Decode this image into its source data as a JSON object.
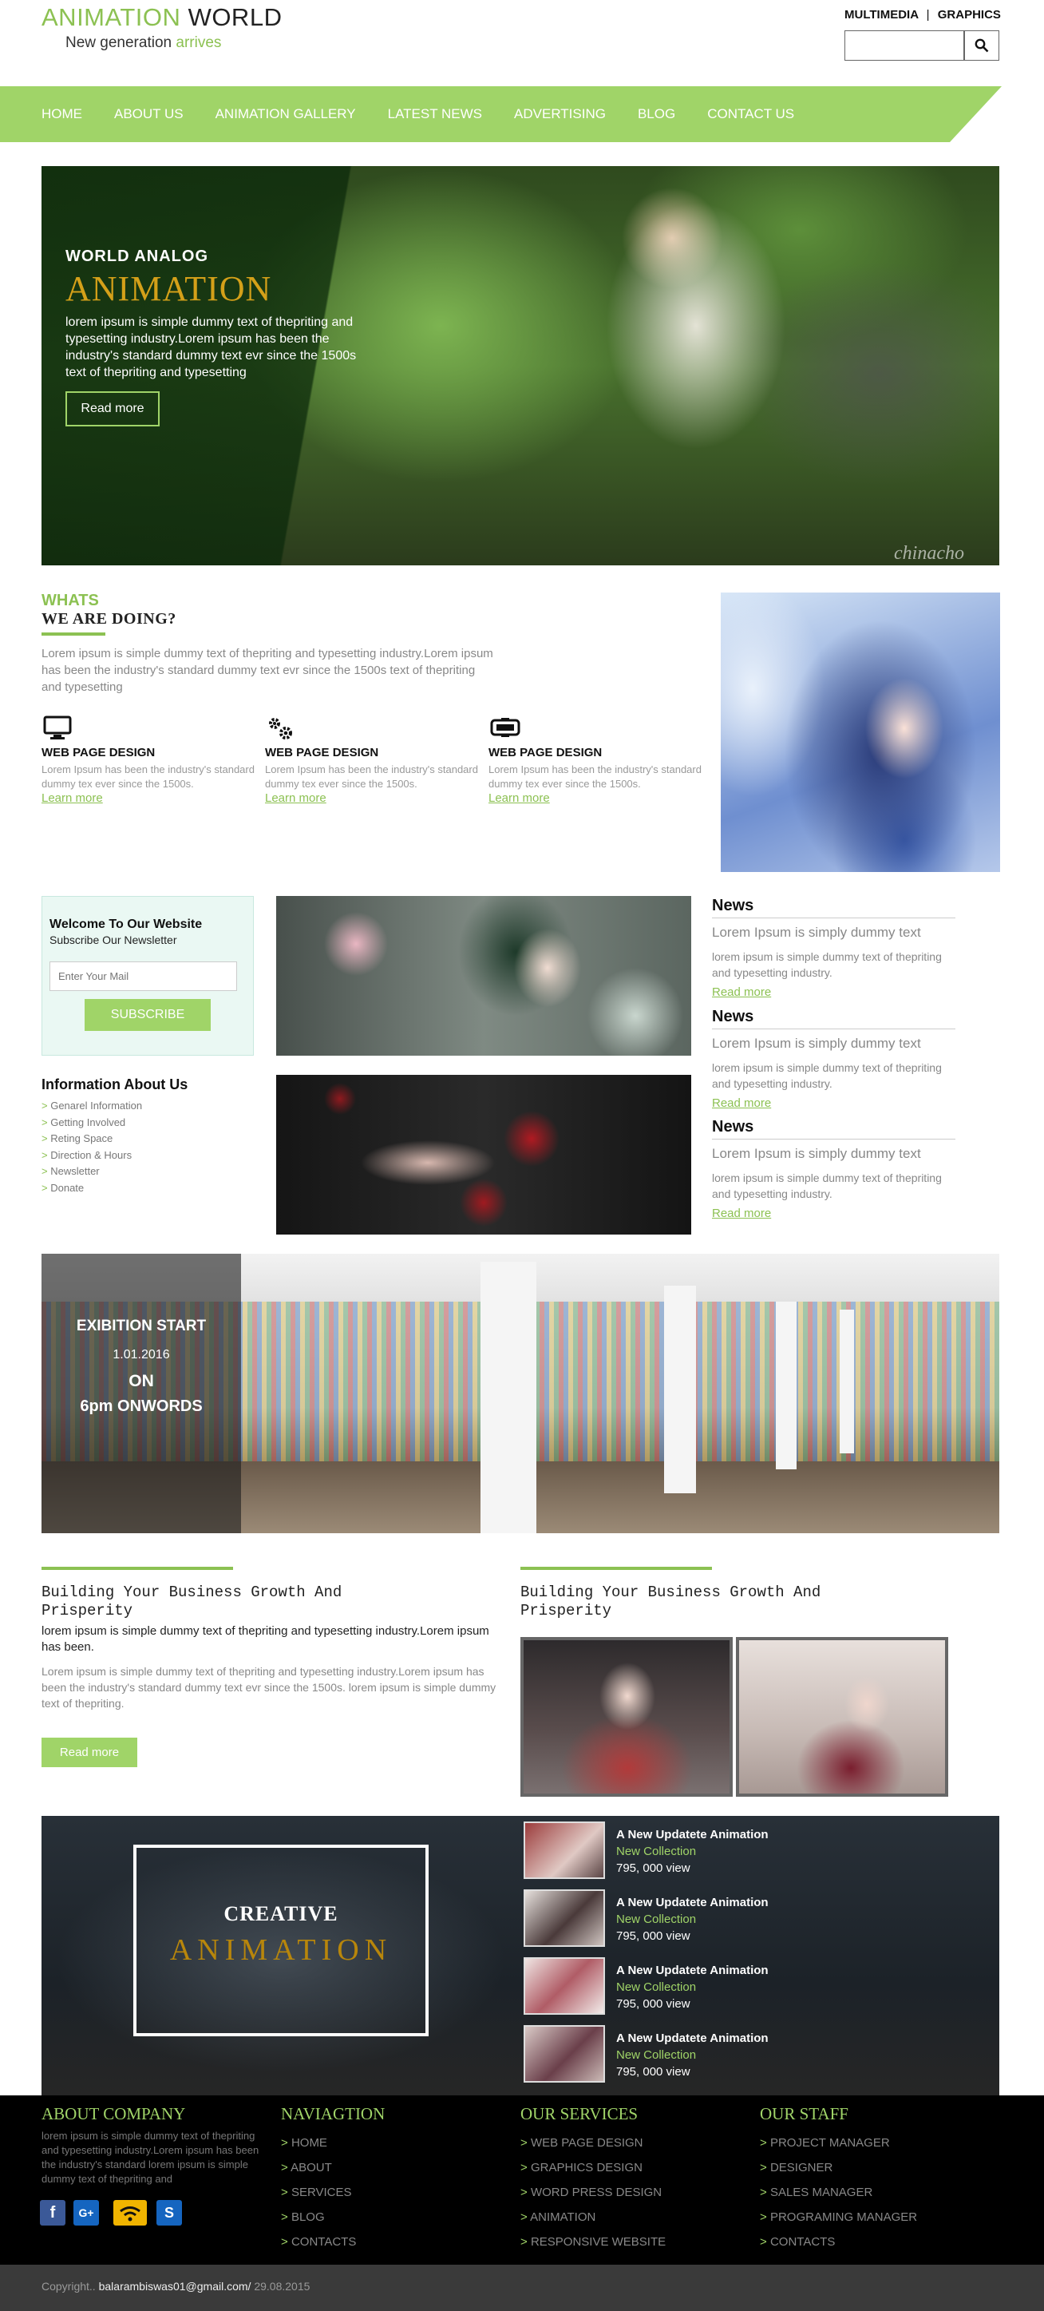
{
  "header": {
    "logo_main": "ANIMATION",
    "logo_accent": "WORLD",
    "tagline_main": "New generation",
    "tagline_accent": "arrives",
    "top_link_1": "MULTIMEDIA",
    "top_sep": "|",
    "top_link_2": "GRAPHICS",
    "search_placeholder": "",
    "search_icon": "search-icon"
  },
  "nav": {
    "items": [
      "HOME",
      "ABOUT US",
      "ANIMATION GALLERY",
      "LATEST NEWS",
      "ADVERTISING",
      "BLOG",
      "CONTACT US"
    ]
  },
  "hero": {
    "small_title": "WORLD  ANALOG",
    "big_title": "ANIMATION",
    "text": "lorem ipsum is simple dummy text of thepriting and typesetting industry.Lorem ipsum has been the industry's standard dummy text evr since the 1500s text of thepriting and typesetting",
    "button": "Read more",
    "watermark": "chinacho"
  },
  "whats": {
    "title_1": "WHATS",
    "title_2": "WE ARE DOING?",
    "text": "Lorem ipsum is simple dummy text of thepriting and typesetting industry.Lorem ipsum has been the industry's standard dummy text evr since the 1500s text of thepriting and typesetting",
    "services": [
      {
        "icon": "monitor-icon",
        "title": "WEB PAGE DESIGN",
        "desc": "Lorem Ipsum has been the industry's standard dummy tex ever since the 1500s.",
        "link": "Learn more"
      },
      {
        "icon": "gears-icon",
        "title": "WEB PAGE DESIGN",
        "desc": "Lorem Ipsum has been the industry's standard dummy tex ever since the 1500s.",
        "link": "Learn more"
      },
      {
        "icon": "device-icon",
        "title": "WEB PAGE DESIGN",
        "desc": "Lorem Ipsum has been the industry's standard dummy tex ever since the 1500s.",
        "link": "Learn more"
      }
    ]
  },
  "newsletter": {
    "title": "Welcome To Our Website",
    "subtitle": "Subscribe Our Newsletter",
    "placeholder": "Enter Your Mail",
    "button": "SUBSCRIBE"
  },
  "info": {
    "title": "Information About Us",
    "items": [
      "Genarel Information",
      "Getting Involved",
      "Reting Space",
      "Direction & Hours",
      "Newsletter",
      "Donate"
    ]
  },
  "news": [
    {
      "heading": "News",
      "subtitle": "Lorem Ipsum is simply dummy text",
      "text": "lorem ipsum is simple dummy text of thepriting and typesetting industry.",
      "link": "Read more"
    },
    {
      "heading": "News",
      "subtitle": "Lorem Ipsum is simply dummy text",
      "text": "lorem ipsum is simple dummy text of thepriting and typesetting industry.",
      "link": "Read more"
    },
    {
      "heading": "News",
      "subtitle": "Lorem Ipsum is simply dummy text",
      "text": "lorem ipsum is simple dummy text of thepriting and typesetting industry.",
      "link": "Read more"
    }
  ],
  "exhibition": {
    "line_1": "EXIBITION START",
    "line_2": "1.01.2016",
    "line_3": "ON",
    "line_4": "6pm ONWORDS"
  },
  "business": {
    "left_title_1": "Building Your Business Growth And",
    "left_title_2": "Prisperity",
    "para_1": "lorem ipsum is simple dummy text of thepriting and typesetting industry.Lorem ipsum has been.",
    "para_2": "Lorem ipsum is simple dummy text of thepriting and typesetting industry.Lorem ipsum has been the industry's standard dummy text evr since the 1500s. lorem ipsum is simple dummy text of thepriting.",
    "button": "Read more",
    "right_title_1": "Building Your Business Growth And",
    "right_title_2": "Prisperity"
  },
  "creative": {
    "title_1": "CREATIVE",
    "title_2": "ANIMATION",
    "items": [
      {
        "title": "A New Updatete Animation",
        "sub": "New Collection",
        "views": "795, 000 view"
      },
      {
        "title": "A New Updatete Animation",
        "sub": "New Collection",
        "views": "795, 000 view"
      },
      {
        "title": "A New Updatete Animation",
        "sub": "New Collection",
        "views": "795, 000 view"
      },
      {
        "title": "A New Updatete Animation",
        "sub": "New Collection",
        "views": "795, 000 view"
      }
    ]
  },
  "footer": {
    "about_title": "ABOUT COMPANY",
    "about_text": "lorem ipsum is simple dummy text of thepriting and typesetting industry.Lorem ipsum has been the industry's standard lorem ipsum is simple dummy text of thepriting and",
    "nav_title": "NAVIAGTION",
    "nav_items": [
      "HOME",
      "ABOUT",
      "SERVICES",
      "BLOG",
      "CONTACTS"
    ],
    "services_title": "OUR SERVICES",
    "services_items": [
      "WEB PAGE DESIGN",
      "GRAPHICS DESIGN",
      "WORD PRESS DESIGN",
      "ANIMATION",
      "RESPONSIVE WEBSITE"
    ],
    "staff_title": "OUR STAFF",
    "staff_items": [
      "PROJECT MANAGER",
      "DESIGNER",
      "SALES MANAGER",
      "PROGRAMING MANAGER",
      "CONTACTS"
    ],
    "arrow": ">",
    "social": [
      {
        "icon": "facebook-icon",
        "glyph": "f",
        "color": "#3b5998"
      },
      {
        "icon": "google-plus-icon",
        "glyph": "G+",
        "color": "#dd4b39"
      },
      {
        "icon": "wifi-icon",
        "glyph": "",
        "color": "#f0b400"
      },
      {
        "icon": "skype-icon",
        "glyph": "S",
        "color": "#00aff0"
      }
    ],
    "copyright_prefix": "Copyright..",
    "copyright_email": "balarambiswas01@gmail.com/",
    "copyright_date": "29.08.2015"
  },
  "colors": {
    "accent": "#a0d468",
    "accent_dark": "#8cc152",
    "gold": "#d4a019"
  }
}
